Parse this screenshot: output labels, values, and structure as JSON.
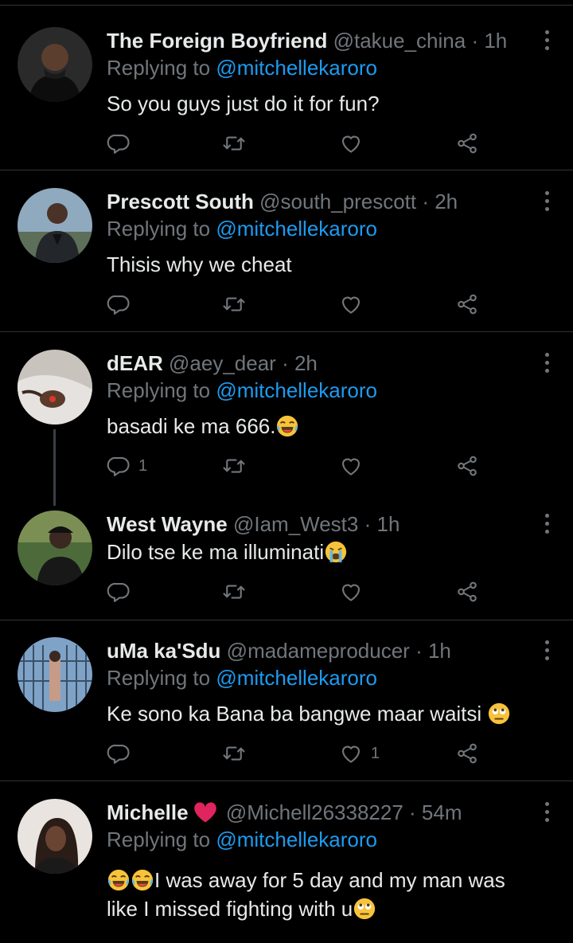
{
  "tweets": [
    {
      "name": "The Foreign Boyfriend",
      "handle": "@takue_china",
      "time": "· 1h",
      "replying_prefix": "Replying to",
      "replying_to": "@mitchellekaroro",
      "text": "So you guys just do it for fun?",
      "reply_count": "",
      "retweet_count": "",
      "like_count": ""
    },
    {
      "name": "Prescott South",
      "handle": "@south_prescott",
      "time": "· 2h",
      "replying_prefix": "Replying to",
      "replying_to": "@mitchellekaroro",
      "text": "Thisis why we cheat",
      "reply_count": "",
      "retweet_count": "",
      "like_count": ""
    },
    {
      "name": "dEAR",
      "handle": "@aey_dear",
      "time": "· 2h",
      "replying_prefix": "Replying to",
      "replying_to": "@mitchellekaroro",
      "text": "basadi ke ma 666.",
      "text_emoji": "joy-emoji",
      "reply_count": "1",
      "retweet_count": "",
      "like_count": ""
    },
    {
      "name": "West Wayne",
      "handle": "@Iam_West3",
      "time": "· 1h",
      "text": "Dilo tse ke ma illuminati",
      "text_emoji": "crying-emoji",
      "reply_count": "",
      "retweet_count": "",
      "like_count": ""
    },
    {
      "name": "uMa ka'Sdu",
      "handle": "@madameproducer",
      "time": "· 1h",
      "replying_prefix": "Replying to",
      "replying_to": "@mitchellekaroro",
      "text": "Ke sono ka Bana ba bangwe maar waitsi ",
      "text_emoji": "eye-roll-emoji",
      "reply_count": "",
      "retweet_count": "",
      "like_count": "1"
    },
    {
      "name": "Michelle",
      "name_emoji": "red-heart-emoji",
      "handle": "@Michell26338227",
      "time": "· 54m",
      "replying_prefix": "Replying to",
      "replying_to": "@mitchellekaroro",
      "text_line1": "I was away for 5 day and my man was",
      "text_line2": "like I missed fighting with u",
      "reply_count": "",
      "retweet_count": "",
      "like_count": ""
    }
  ],
  "icons": {
    "reply": "reply-icon",
    "retweet": "retweet-icon",
    "like": "heart-icon",
    "share": "share-icon",
    "more": "more-icon"
  },
  "colors": {
    "background": "#000000",
    "text": "#e7e9ea",
    "secondary": "#71767b",
    "link": "#1d9bf0",
    "divider": "#2f3336"
  }
}
